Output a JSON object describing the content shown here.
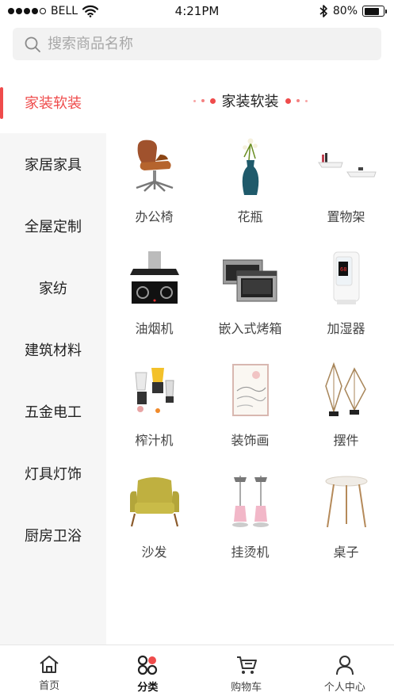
{
  "status_bar": {
    "carrier": "BELL",
    "time": "4:21PM",
    "battery_percent": "80%",
    "battery_level": 0.8,
    "signal_bars_filled": 4,
    "icons": [
      "wifi-icon",
      "bluetooth-icon",
      "battery-icon"
    ]
  },
  "search": {
    "placeholder": "搜索商品名称",
    "icon": "search-icon"
  },
  "sidebar": {
    "active_index": 0,
    "accent_color": "#ef4b4b",
    "items": [
      {
        "label": "家装软装"
      },
      {
        "label": "家居家具"
      },
      {
        "label": "全屋定制"
      },
      {
        "label": "家纺"
      },
      {
        "label": "建筑材料"
      },
      {
        "label": "五金电工"
      },
      {
        "label": "灯具灯饰"
      },
      {
        "label": "厨房卫浴"
      }
    ]
  },
  "content": {
    "section_title": "家装软装",
    "products": [
      {
        "label": "办公椅",
        "icon": "office-chair-icon"
      },
      {
        "label": "花瓶",
        "icon": "vase-icon"
      },
      {
        "label": "置物架",
        "icon": "shelf-icon"
      },
      {
        "label": "油烟机",
        "icon": "range-hood-icon"
      },
      {
        "label": "嵌入式烤箱",
        "icon": "oven-icon"
      },
      {
        "label": "加湿器",
        "icon": "humidifier-icon"
      },
      {
        "label": "榨汁机",
        "icon": "juicer-icon"
      },
      {
        "label": "装饰画",
        "icon": "painting-icon"
      },
      {
        "label": "摆件",
        "icon": "ornament-icon"
      },
      {
        "label": "沙发",
        "icon": "sofa-icon"
      },
      {
        "label": "挂烫机",
        "icon": "steamer-icon"
      },
      {
        "label": "桌子",
        "icon": "table-icon"
      }
    ]
  },
  "tabbar": {
    "active_index": 1,
    "items": [
      {
        "label": "首页",
        "icon": "home-icon"
      },
      {
        "label": "分类",
        "icon": "category-icon"
      },
      {
        "label": "购物车",
        "icon": "cart-icon"
      },
      {
        "label": "个人中心",
        "icon": "user-icon"
      }
    ]
  }
}
